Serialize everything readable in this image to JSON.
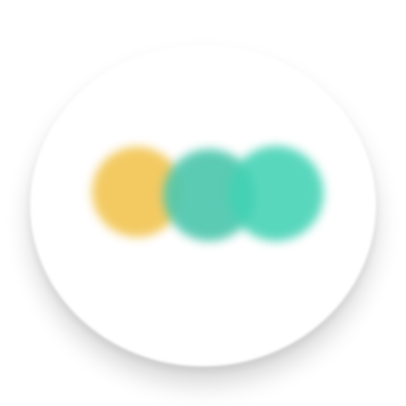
{
  "app_icon": {
    "icon_name": "three-dots-logo-icon",
    "colors": {
      "background": "#ffffff",
      "dot_left": "#f3c95f",
      "dot_middle": "#4fc7ae",
      "dot_right": "#43d2b4"
    }
  }
}
